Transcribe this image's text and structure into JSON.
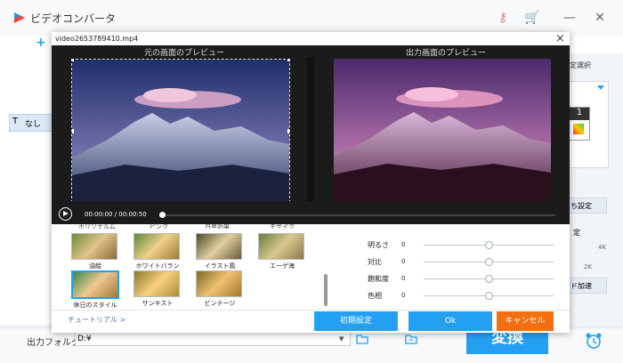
{
  "app": {
    "title": "ビデオコンバータ"
  },
  "left": {
    "item": "なし"
  },
  "right": {
    "text1": "定選択",
    "text2": "ち設定",
    "text3": "定",
    "text4": "4K",
    "text5": "2K",
    "text6": "ド加速",
    "badge": "1"
  },
  "bottom": {
    "output_label": "出力フォルダ：",
    "output_value": "D:¥",
    "convert_label": "変換"
  },
  "dialog": {
    "title": "video2653789410.mp4",
    "original_preview_label": "元の画面のプレビュー",
    "output_preview_label": "出力画面のプレビュー",
    "time": "00:00:00 / 00:00:50",
    "filters_row1": [
      "油絵",
      "ホワイトバランス",
      "イラスト風",
      "エーゲ海"
    ],
    "filters_row2": [
      "休日のスタイル",
      "サンキスト",
      "ビンテージ"
    ],
    "filters_top_partial": [
      "ホリソナルム",
      "ピンク",
      "白黒効果",
      "モザイク"
    ],
    "tutorial_link": "チュートリアル >",
    "adjustments": [
      {
        "label": "明るさ",
        "value": "0",
        "position": 0.5
      },
      {
        "label": "対比",
        "value": "0",
        "position": 0.5
      },
      {
        "label": "飽和度",
        "value": "0",
        "position": 0.5
      },
      {
        "label": "色相",
        "value": "0",
        "position": 0.5
      }
    ],
    "reset_button": "初期設定",
    "ok_button": "Ok",
    "cancel_button": "キャンセル"
  },
  "colors": {
    "accent": "#24a0f2",
    "cancel": "#f36f12"
  }
}
